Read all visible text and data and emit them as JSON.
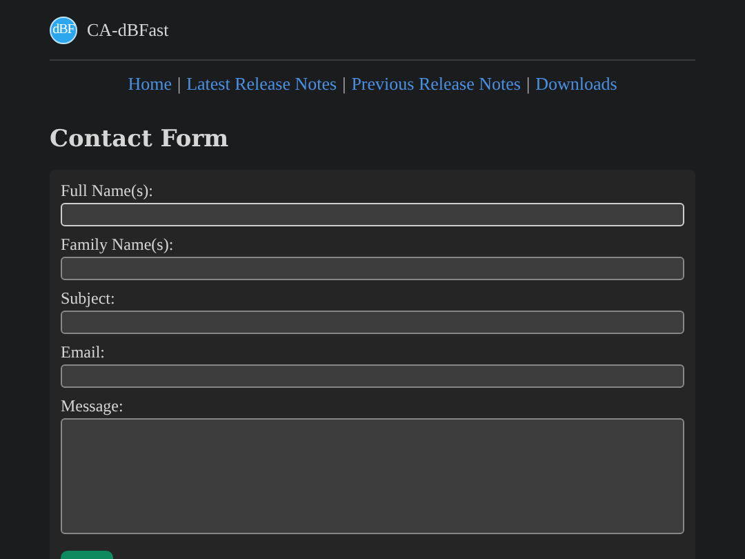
{
  "site": {
    "logo": "dBF",
    "name": "CA-dBFast"
  },
  "nav": [
    "Home",
    "Latest Release Notes",
    "Previous Release Notes",
    "Downloads"
  ],
  "nav_separator": "|",
  "heading": "Contact Form",
  "form": {
    "fields": [
      {
        "label": "Full Name(s):",
        "kind": "text",
        "focused": true
      },
      {
        "label": "Family Name(s):",
        "kind": "text",
        "focused": false
      },
      {
        "label": "Subject:",
        "kind": "text",
        "focused": false
      },
      {
        "label": "Email:",
        "kind": "text",
        "focused": false
      },
      {
        "label": "Message:",
        "kind": "textarea",
        "focused": false
      }
    ]
  }
}
